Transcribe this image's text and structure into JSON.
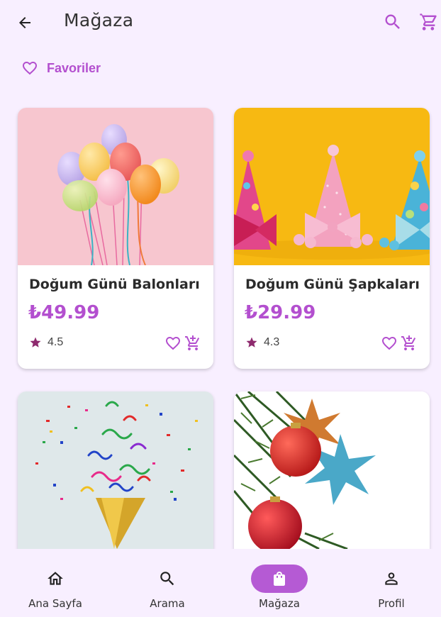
{
  "header": {
    "title": "Mağaza",
    "back_icon": "arrow-back-icon",
    "search_icon": "search-icon",
    "cart_icon": "shopping-cart-icon"
  },
  "favorites": {
    "label": "Favoriler",
    "icon": "heart-outline-icon"
  },
  "products": [
    {
      "name": "Doğum Günü Balonları",
      "price": "₺49.99",
      "rating": "4.5",
      "image": "balloons-image"
    },
    {
      "name": "Doğum Günü Şapkaları",
      "price": "₺29.99",
      "rating": "4.3",
      "image": "party-hats-image"
    },
    {
      "name": "",
      "price": "",
      "rating": "",
      "image": "confetti-cone-image"
    },
    {
      "name": "",
      "price": "",
      "rating": "",
      "image": "christmas-ornaments-image"
    }
  ],
  "bottom_nav": {
    "items": [
      {
        "label": "Ana Sayfa",
        "icon": "home-icon"
      },
      {
        "label": "Arama",
        "icon": "search-icon"
      },
      {
        "label": "Mağaza",
        "icon": "shopping-bag-icon",
        "active": true
      },
      {
        "label": "Profil",
        "icon": "person-icon"
      }
    ]
  },
  "colors": {
    "accent": "#b34fcf",
    "background": "#f8efff",
    "nav_active": "#b55ad4",
    "star": "#8e2a6e"
  }
}
